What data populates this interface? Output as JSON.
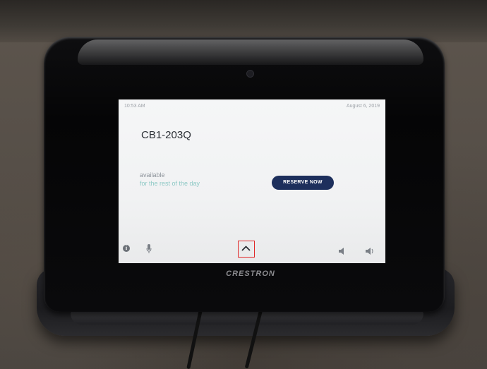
{
  "device": {
    "brand": "CRESTRON"
  },
  "screen": {
    "time": "10:53 AM",
    "date": "August 6, 2019",
    "room_name": "CB1-203Q",
    "status": "available",
    "status_detail": "for the rest of the day",
    "reserve_button": "RESERVE NOW"
  },
  "icons": {
    "info": "info-icon",
    "mic": "microphone-icon",
    "expand": "chevron-up-icon",
    "volume_down": "speaker-icon",
    "volume_up": "speaker-icon"
  },
  "colors": {
    "reserve_button_bg": "#1d2f5c",
    "status_detail_text": "#8fc9c6",
    "highlight_box": "#e02828"
  }
}
